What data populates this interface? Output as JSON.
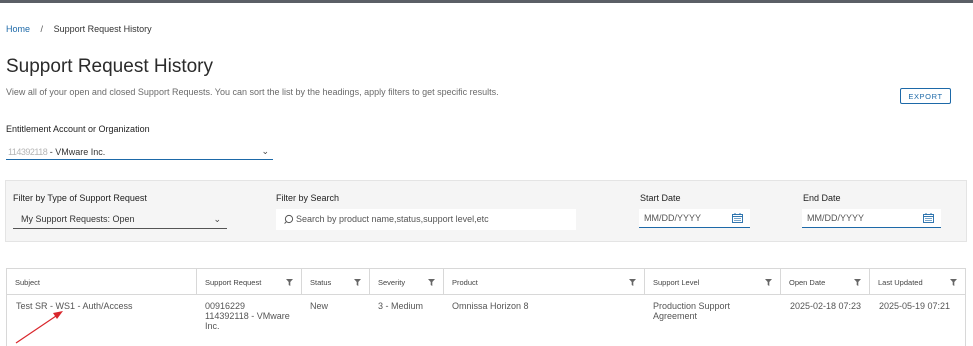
{
  "breadcrumb": {
    "home": "Home",
    "separator": "/",
    "current": "Support Request History"
  },
  "page": {
    "title": "Support Request History",
    "description": "View all of your open and closed Support Requests. You can sort the list by the headings, apply filters to get specific results."
  },
  "export_label": "EXPORT",
  "entitlement": {
    "label": "Entitlement Account or Organization",
    "value_redacted": "114392118",
    "value_suffix": " - VMware Inc."
  },
  "filters": {
    "type": {
      "label": "Filter by Type of Support Request",
      "value": "My Support Requests: Open"
    },
    "search": {
      "label": "Filter by Search",
      "placeholder": "Search by product name,status,support level,etc"
    },
    "start_date": {
      "label": "Start Date",
      "placeholder": "MM/DD/YYYY"
    },
    "end_date": {
      "label": "End Date",
      "placeholder": "MM/DD/YYYY"
    }
  },
  "table": {
    "columns": [
      "Subject",
      "Support Request",
      "Status",
      "Severity",
      "Product",
      "Support Level",
      "Open Date",
      "Last Updated"
    ],
    "rows": [
      {
        "subject": "Test SR - WS1 - Auth/Access",
        "sr_number": "00916229",
        "sr_account": "114392118 - VMware",
        "sr_org": "Inc.",
        "status": "New",
        "severity": "3 - Medium",
        "product": "Omnissa Horizon 8",
        "support_level_1": "Production Support",
        "support_level_2": "Agreement",
        "open_date": "2025-02-18 07:23",
        "last_updated": "2025-05-19 07:21"
      }
    ]
  },
  "colors": {
    "accent": "#1d69a8",
    "annotation_arrow": "#d9262b",
    "panel_bg": "#f5f5f5"
  },
  "icons": [
    "search-icon",
    "calendar-icon",
    "filter-icon",
    "chevron-down-icon"
  ]
}
